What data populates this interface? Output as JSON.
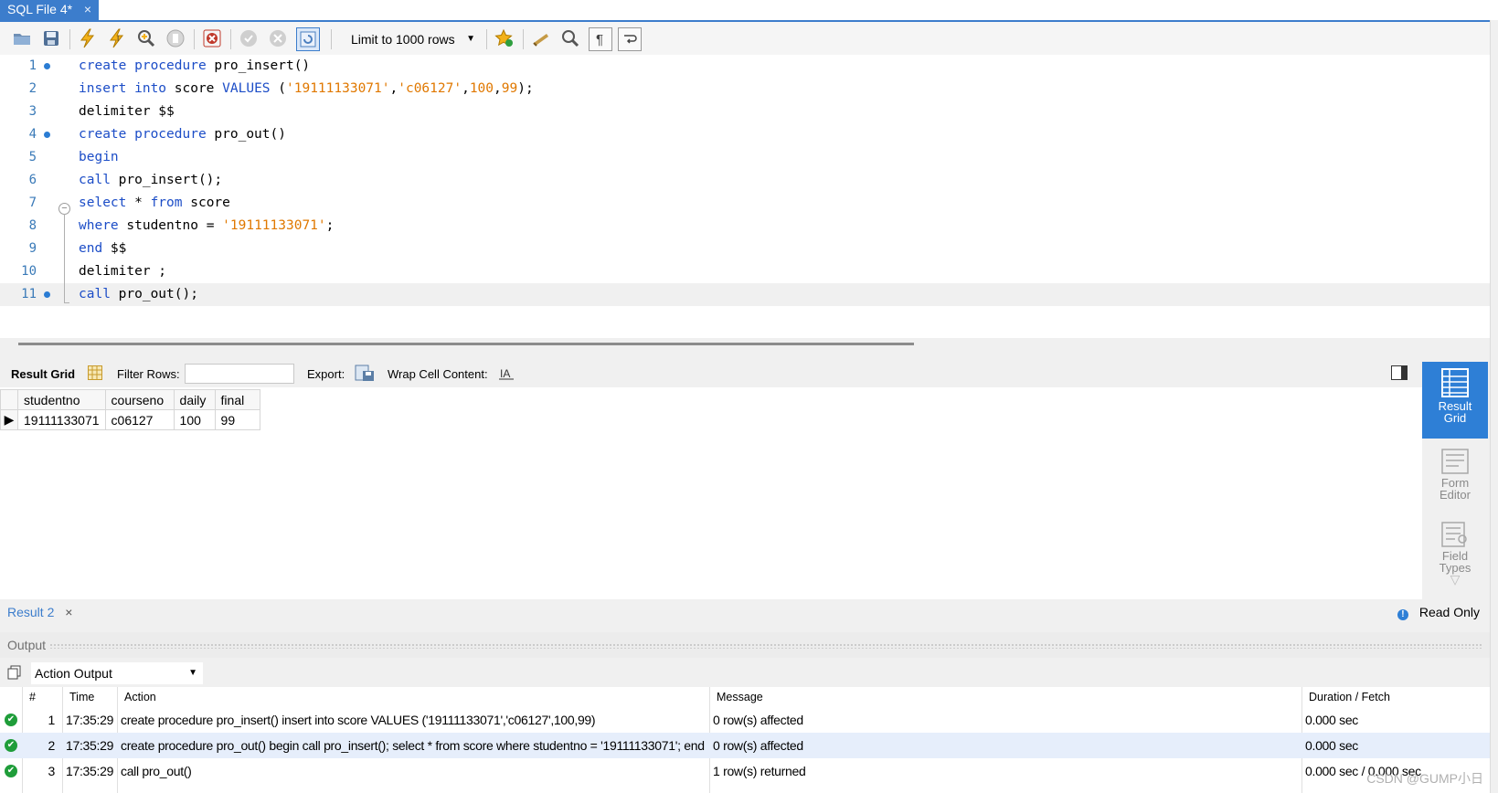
{
  "tabs": [
    {
      "label": "SQL File 4*",
      "close": "×"
    }
  ],
  "toolbar": {
    "limit_label": "Limit to 1000 rows",
    "icons": [
      "open-folder-icon",
      "save-icon",
      "execute-icon",
      "execute-current-icon",
      "explain-icon",
      "stop-icon",
      "toggle-error-icon",
      "commit-icon",
      "rollback-icon",
      "autocommit-icon",
      "bookmark-icon",
      "beautify-icon",
      "find-icon",
      "invisibles-icon",
      "wrap-icon"
    ]
  },
  "editor": {
    "lines": [
      {
        "n": "1",
        "bp": true,
        "tokens": [
          [
            "kw",
            "create procedure "
          ],
          [
            "",
            "pro_insert()"
          ]
        ]
      },
      {
        "n": "2",
        "bp": false,
        "tokens": [
          [
            "kw",
            "insert into "
          ],
          [
            "",
            "score "
          ],
          [
            "kw",
            "VALUES "
          ],
          [
            "",
            "("
          ],
          [
            "str",
            "'19111133071'"
          ],
          [
            "",
            ","
          ],
          [
            "str",
            "'c06127'"
          ],
          [
            "",
            ","
          ],
          [
            "num",
            "100"
          ],
          [
            "",
            ","
          ],
          [
            "num",
            "99"
          ],
          [
            "",
            ");"
          ]
        ]
      },
      {
        "n": "3",
        "bp": false,
        "tokens": [
          [
            "",
            "delimiter $$"
          ]
        ]
      },
      {
        "n": "4",
        "bp": true,
        "tokens": [
          [
            "kw",
            "create procedure "
          ],
          [
            "",
            "pro_out()"
          ]
        ]
      },
      {
        "n": "5",
        "bp": false,
        "tokens": [
          [
            "kw",
            "begin"
          ]
        ]
      },
      {
        "n": "6",
        "bp": false,
        "tokens": [
          [
            "kw",
            "call "
          ],
          [
            "",
            "pro_insert();"
          ]
        ]
      },
      {
        "n": "7",
        "bp": false,
        "tokens": [
          [
            "kw",
            "select "
          ],
          [
            "",
            "* "
          ],
          [
            "kw",
            "from "
          ],
          [
            "",
            "score"
          ]
        ]
      },
      {
        "n": "8",
        "bp": false,
        "tokens": [
          [
            "kw",
            "where "
          ],
          [
            "",
            "studentno = "
          ],
          [
            "str",
            "'19111133071'"
          ],
          [
            "",
            ";"
          ]
        ]
      },
      {
        "n": "9",
        "bp": false,
        "tokens": [
          [
            "kw",
            "end "
          ],
          [
            "",
            "$$"
          ]
        ]
      },
      {
        "n": "10",
        "bp": false,
        "tokens": [
          [
            "",
            "delimiter ;"
          ]
        ]
      },
      {
        "n": "11",
        "bp": true,
        "current": true,
        "tokens": [
          [
            "kw",
            "call "
          ],
          [
            "",
            "pro_out();"
          ]
        ]
      }
    ]
  },
  "result_toolbar": {
    "result_grid": "Result Grid",
    "filter_rows": "Filter Rows:",
    "export": "Export:",
    "wrap": "Wrap Cell Content:"
  },
  "grid": {
    "columns": [
      "studentno",
      "courseno",
      "daily",
      "final"
    ],
    "rows": [
      [
        "19111133071",
        "c06127",
        "100",
        "99"
      ]
    ]
  },
  "side_panel": {
    "result_grid": [
      "Result",
      "Grid"
    ],
    "form_editor": [
      "Form",
      "Editor"
    ],
    "field_types": [
      "Field",
      "Types"
    ]
  },
  "result_tab": {
    "label": "Result 2",
    "close": "×",
    "read_only": "Read Only"
  },
  "output": {
    "header": "Output",
    "select": "Action Output",
    "columns": [
      "#",
      "Time",
      "Action",
      "Message",
      "Duration / Fetch"
    ],
    "rows": [
      {
        "n": "1",
        "time": "17:35:29",
        "action": "create procedure pro_insert() insert into score VALUES ('19111133071','c06127',100,99)",
        "message": "0 row(s) affected",
        "duration": "0.000 sec"
      },
      {
        "n": "2",
        "time": "17:35:29",
        "action": "create procedure pro_out() begin call pro_insert(); select * from score where studentno = '19111133071'; end",
        "message": "0 row(s) affected",
        "duration": "0.000 sec"
      },
      {
        "n": "3",
        "time": "17:35:29",
        "action": "call pro_out()",
        "message": "1 row(s) returned",
        "duration": "0.000 sec / 0.000 sec"
      }
    ]
  },
  "watermark": "CSDN @GUMP小日"
}
